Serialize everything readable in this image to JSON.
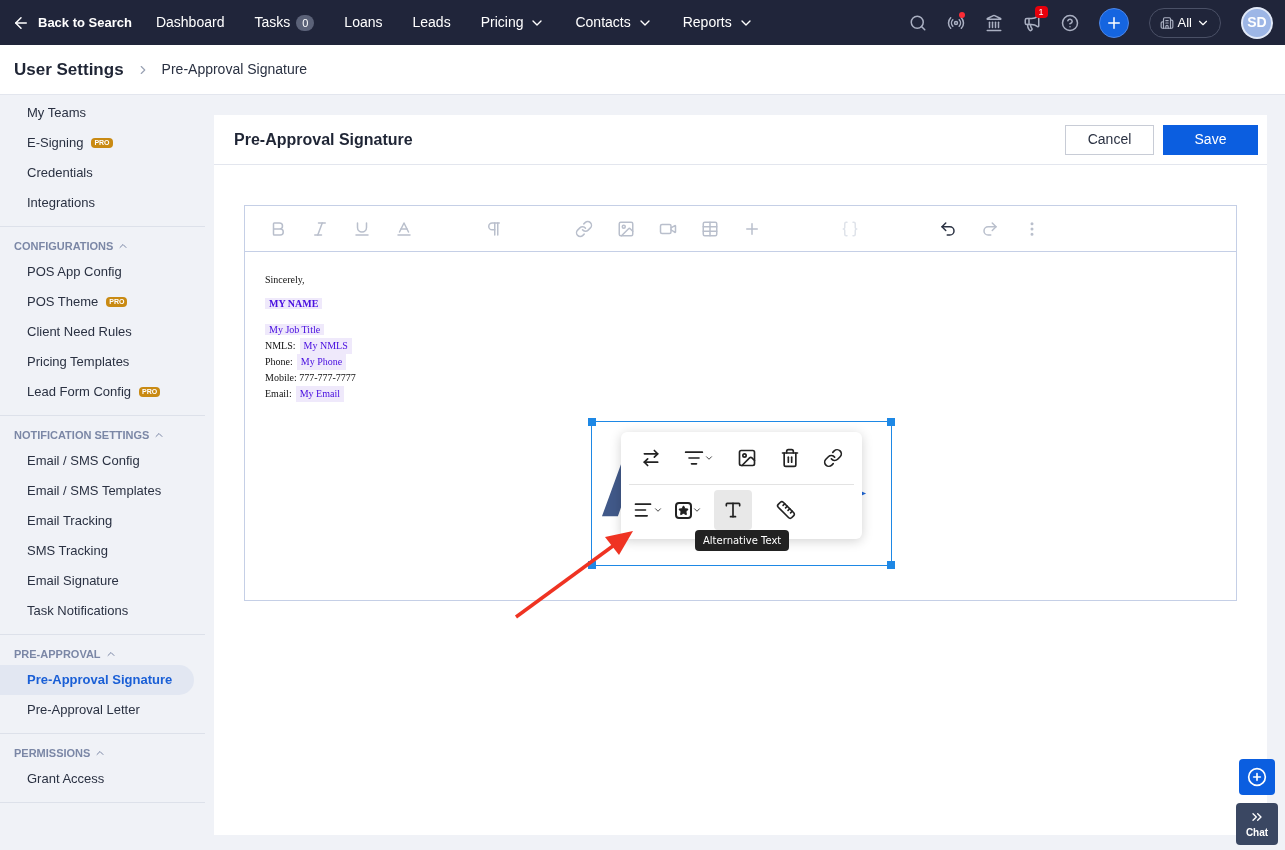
{
  "top_nav": {
    "back_link": "Back to Search",
    "items": [
      {
        "label": "Dashboard",
        "kind": "link"
      },
      {
        "label": "Tasks",
        "kind": "link",
        "badge": "0"
      },
      {
        "label": "Loans",
        "kind": "link"
      },
      {
        "label": "Leads",
        "kind": "link"
      },
      {
        "label": "Pricing",
        "kind": "dropdown"
      },
      {
        "label": "Contacts",
        "kind": "dropdown"
      },
      {
        "label": "Reports",
        "kind": "dropdown"
      }
    ],
    "notification_count": "1",
    "scope": "All",
    "avatar": "SD"
  },
  "breadcrumb": [
    "User Settings",
    "Pre-Approval Signature"
  ],
  "sidebar": {
    "sections": [
      {
        "items": [
          {
            "label": "My Teams",
            "selected": false
          },
          {
            "label": "E-Signing",
            "pro": "PRO",
            "selected": false
          },
          {
            "label": "Credentials",
            "selected": false
          },
          {
            "label": "Integrations",
            "selected": false
          }
        ]
      },
      {
        "title": "CONFIGURATIONS",
        "expanded": true,
        "items": [
          {
            "label": "POS App Config",
            "selected": false
          },
          {
            "label": "POS Theme",
            "pro": "PRO",
            "selected": false
          },
          {
            "label": "Client Need Rules",
            "selected": false
          },
          {
            "label": "Pricing Templates",
            "selected": false
          },
          {
            "label": "Lead Form Config",
            "pro": "PRO",
            "selected": false
          }
        ]
      },
      {
        "title": "NOTIFICATION SETTINGS",
        "expanded": true,
        "items": [
          {
            "label": "Email / SMS Config",
            "selected": false
          },
          {
            "label": "Email / SMS Templates",
            "selected": false
          },
          {
            "label": "Email Tracking",
            "selected": false
          },
          {
            "label": "SMS Tracking",
            "selected": false
          },
          {
            "label": "Email Signature",
            "selected": false
          },
          {
            "label": "Task Notifications",
            "selected": false
          }
        ]
      },
      {
        "title": "PRE-APPROVAL",
        "expanded": true,
        "items": [
          {
            "label": "Pre-Approval Signature",
            "selected": true
          },
          {
            "label": "Pre-Approval Letter",
            "selected": false
          }
        ]
      },
      {
        "title": "PERMISSIONS",
        "expanded": true,
        "items": [
          {
            "label": "Grant Access",
            "selected": false
          }
        ]
      }
    ]
  },
  "panel": {
    "title": "Pre-Approval Signature",
    "buttons": [
      {
        "label": "Cancel",
        "kind": "secondary"
      },
      {
        "label": "Save",
        "kind": "primary"
      }
    ]
  },
  "signature": [
    {
      "kind": "plain",
      "text": "Sincerely,"
    },
    {
      "kind": "name",
      "token": "MY NAME"
    },
    {
      "kind": "token",
      "token": "My Job Title"
    },
    {
      "kind": "labeled_token",
      "label": "NMLS:",
      "token": "My NMLS"
    },
    {
      "kind": "labeled_token",
      "label": "Phone:",
      "token": "My Phone"
    },
    {
      "kind": "plain",
      "text": "Mobile: 777-777-7777"
    },
    {
      "kind": "labeled_token",
      "label": "Email:",
      "token": "My Email"
    }
  ],
  "image_tooltip": "Alternative Text",
  "chat_label": "Chat"
}
